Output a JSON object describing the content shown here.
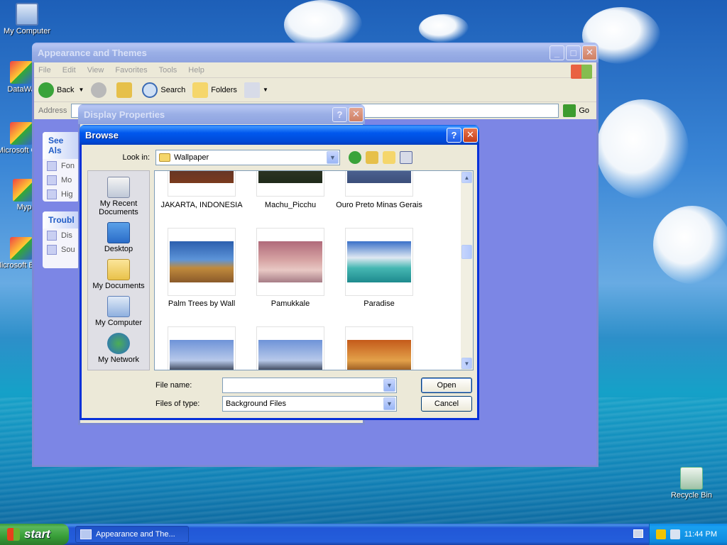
{
  "desktop": {
    "icons": [
      {
        "label": "My Computer"
      },
      {
        "label": "DataWa"
      },
      {
        "label": "Microsoft C++"
      },
      {
        "label": "Myp"
      },
      {
        "label": "Microsoft Basic"
      },
      {
        "label": "Recycle Bin"
      }
    ]
  },
  "explorer": {
    "title": "Appearance and Themes",
    "menu": [
      "File",
      "Edit",
      "View",
      "Favorites",
      "Tools",
      "Help"
    ],
    "toolbar": {
      "back": "Back",
      "search": "Search",
      "folders": "Folders"
    },
    "address_label": "Address",
    "go_label": "Go",
    "see_also_header": "See Als",
    "see_also_items": [
      "Fon",
      "Mo",
      "Hig"
    ],
    "troubleshoot_header": "Troubl",
    "troubleshoot_items": [
      "Dis",
      "Sou"
    ]
  },
  "display_properties": {
    "title": "Display Properties"
  },
  "browse": {
    "title": "Browse",
    "look_in_label": "Look in:",
    "look_in_value": "Wallpaper",
    "places": [
      "My Recent Documents",
      "Desktop",
      "My Documents",
      "My Computer",
      "My Network"
    ],
    "files_row1": [
      "JAKARTA, INDONESIA",
      "Machu_Picchu",
      "Ouro Preto Minas Gerais"
    ],
    "files_row2": [
      "Palm Trees by Wall",
      "Pamukkale",
      "Paradise"
    ],
    "file_name_label": "File name:",
    "file_name_value": "",
    "files_of_type_label": "Files of type:",
    "files_of_type_value": "Background Files",
    "open_label": "Open",
    "cancel_label": "Cancel",
    "help_button": "?",
    "close_button": "✕"
  },
  "taskbar": {
    "start_label": "start",
    "task_button": "Appearance and The...",
    "clock": "11:44 PM"
  },
  "colors": {
    "xp_blue": "#0831d9",
    "start_green": "#389e38"
  }
}
